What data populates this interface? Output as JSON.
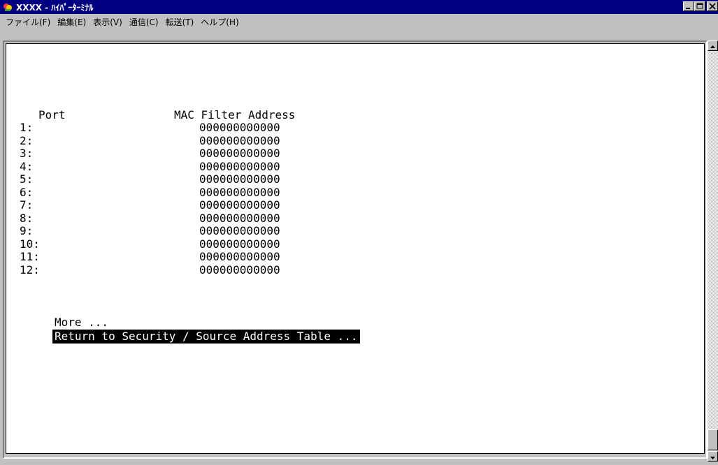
{
  "window": {
    "title": "XXXX - ﾊｲﾊﾟｰﾀｰﾐﾅﾙ",
    "minimize_label": "_",
    "maximize_label": "□",
    "close_label": "×"
  },
  "menu": {
    "items": [
      {
        "label": "ファイル(F)"
      },
      {
        "label": "編集(E)"
      },
      {
        "label": "表示(V)"
      },
      {
        "label": "通信(C)"
      },
      {
        "label": "転送(T)"
      },
      {
        "label": "ヘルプ(H)"
      }
    ]
  },
  "terminal": {
    "header_port": "Port",
    "header_mac": "MAC Filter Address",
    "rows": [
      {
        "port": "1:",
        "mac": "000000000000"
      },
      {
        "port": "2:",
        "mac": "000000000000"
      },
      {
        "port": "3:",
        "mac": "000000000000"
      },
      {
        "port": "4:",
        "mac": "000000000000"
      },
      {
        "port": "5:",
        "mac": "000000000000"
      },
      {
        "port": "6:",
        "mac": "000000000000"
      },
      {
        "port": "7:",
        "mac": "000000000000"
      },
      {
        "port": "8:",
        "mac": "000000000000"
      },
      {
        "port": "9:",
        "mac": "000000000000"
      },
      {
        "port": "10:",
        "mac": "000000000000"
      },
      {
        "port": "11:",
        "mac": "000000000000"
      },
      {
        "port": "12:",
        "mac": "000000000000"
      }
    ],
    "more_label": "More ...",
    "return_label": "Return to Security / Source Address Table ..."
  },
  "colors": {
    "titlebar": "#000080",
    "window_bg": "#c0c0c0",
    "terminal_bg": "#ffffff",
    "terminal_text": "#000000",
    "highlight_bg": "#000000",
    "highlight_text": "#ffffff"
  },
  "icons": {
    "app": "hyperterminal-icon",
    "minimize": "minimize-icon",
    "maximize": "maximize-icon",
    "close": "close-icon",
    "scroll_up": "arrow-up-icon",
    "scroll_down": "arrow-down-icon"
  }
}
